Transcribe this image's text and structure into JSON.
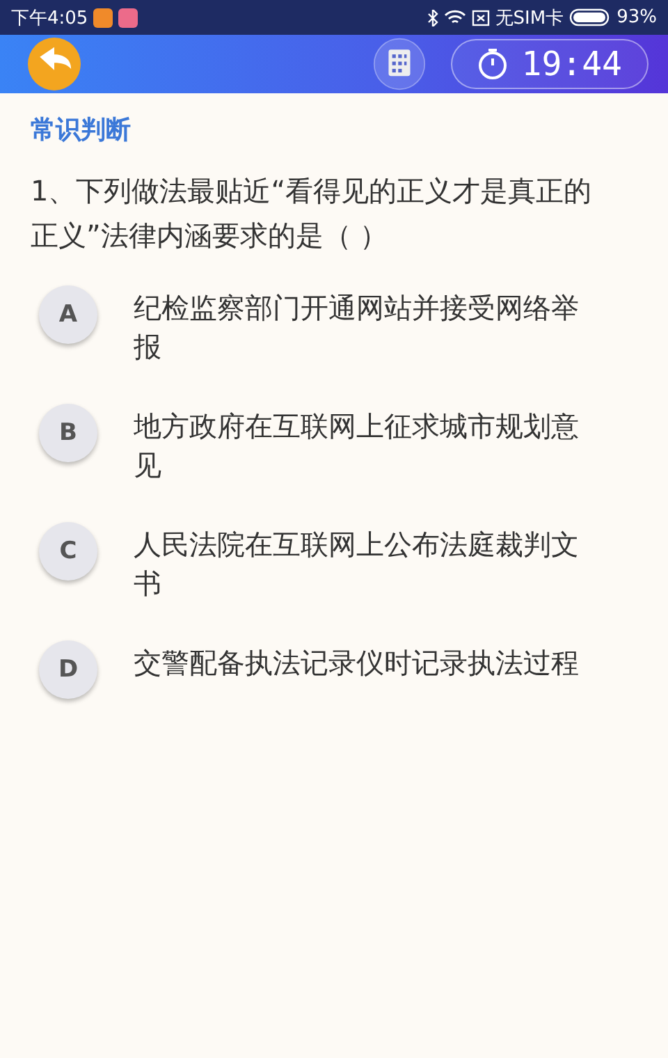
{
  "status_bar": {
    "time": "下午4:05",
    "carrier": "无SIM卡",
    "battery": "93%"
  },
  "header": {
    "timer": "19:44"
  },
  "section": "常识判断",
  "question": "1、下列做法最贴近“看得见的正义才是真正的正义”法律内涵要求的是（  ）",
  "options": [
    {
      "letter": "A",
      "text": "纪检监察部门开通网站并接受网络举报",
      "selected": false
    },
    {
      "letter": "B",
      "text": "地方政府在互联网上征求城市规划意见",
      "selected": false
    },
    {
      "letter": "C",
      "text": "人民法院在互联网上公布法庭裁判文书",
      "selected": false
    },
    {
      "letter": "D",
      "text": "交警配备执法记录仪时记录执法过程",
      "selected": false
    }
  ]
}
